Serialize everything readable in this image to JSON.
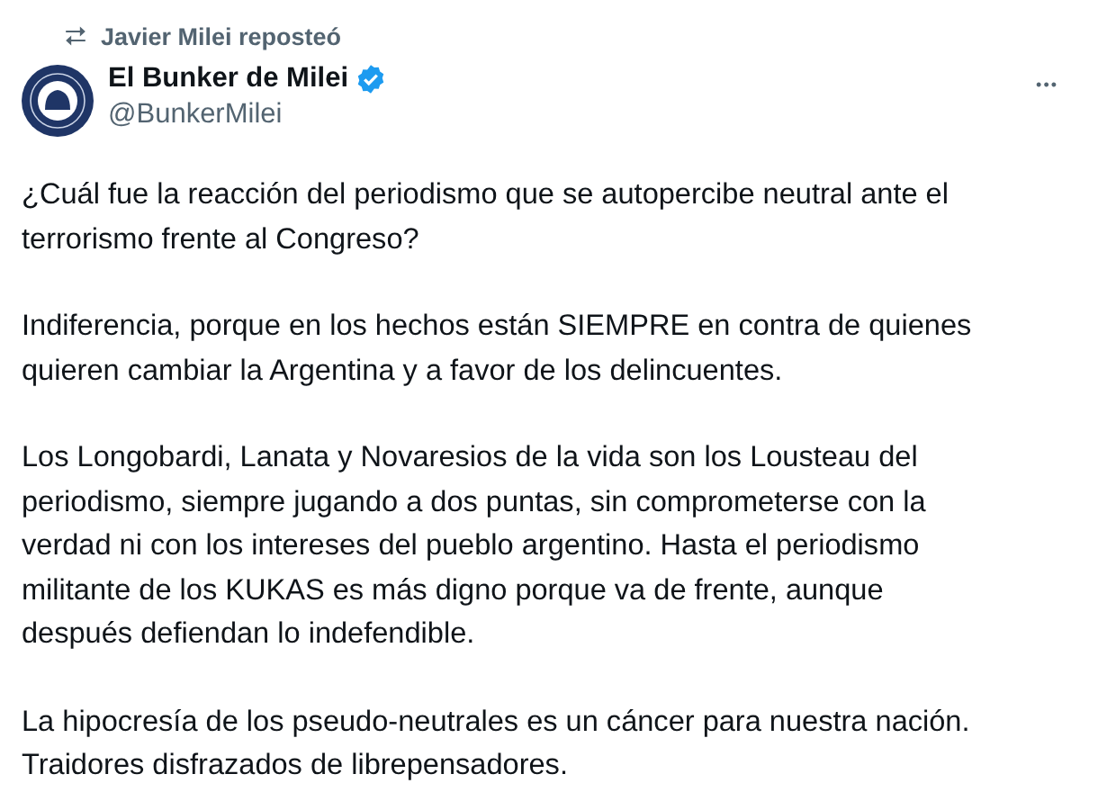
{
  "repost": {
    "icon": "⮂",
    "text": "Javier Milei reposteó"
  },
  "author": {
    "name": "El Bunker de Milei",
    "verified": true,
    "handle": "@BunkerMilei"
  },
  "more": "•••",
  "paragraphs": [
    "¿Cuál fue la reacción del periodismo que se autopercibe neutral ante el\nterrorismo frente al Congreso?",
    "Indiferencia, porque en los hechos están SIEMPRE en contra de quienes\nquieren cambiar la Argentina y a favor de los delincuentes.",
    "Los Longobardi, Lanata y Novaresios de la vida son los Lousteau del\nperiodismo, siempre jugando a dos puntas, sin comprometerse con la\nverdad ni con los intereses del pueblo argentino. Hasta el periodismo\nmilitante de los KUKAS es más digno porque va de frente, aunque\ndespués defiendan lo indefendible.",
    "La hipocresía de los pseudo-neutrales es un cáncer para nuestra nación.\nTraidores disfrazados de librepensadores."
  ]
}
